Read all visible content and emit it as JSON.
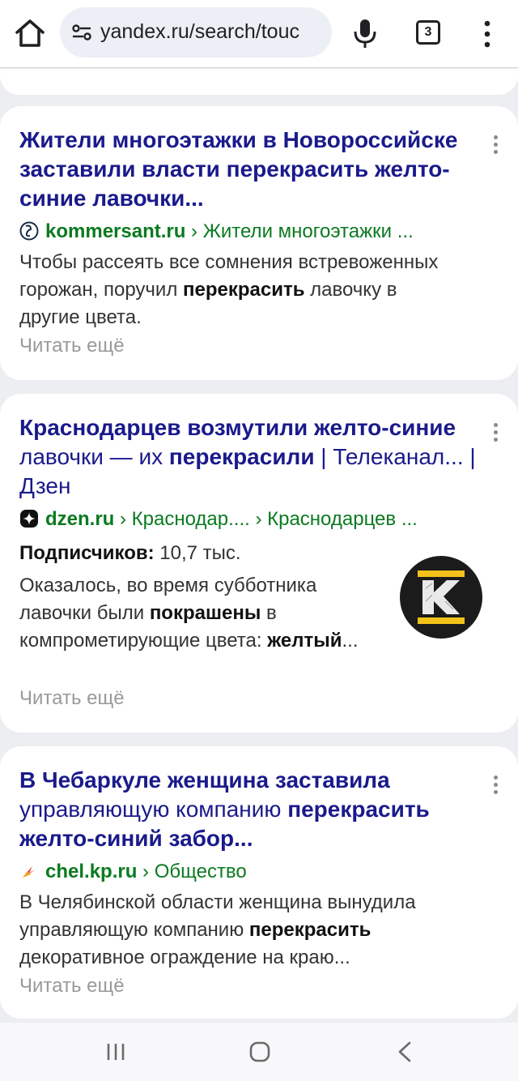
{
  "browser": {
    "url": "yandex.ru/search/touc",
    "tab_count": "3"
  },
  "results": [
    {
      "title_parts": [
        "Жители многоэтажки в Новороссийске заставили власти ",
        "перекрасить желто-синие лавочки..."
      ],
      "domain": "kommersant.ru",
      "breadcrumb": " › Жители многоэтажки ...",
      "snippet_pre": "Чтобы рассеять все сомнения встревоженных горожан, поручил ",
      "snippet_bold": "перекрасить",
      "snippet_post": " лавочку в другие цвета.",
      "more": "Читать ещё"
    },
    {
      "title_b1": "Краснодарцев возмутили желто-синие",
      "title_n1": " лавочки — их ",
      "title_b2": "перекрасили",
      "title_b3": " | Телеканал... | Дзен",
      "domain": "dzen.ru",
      "breadcrumb": " › Краснодар.... › Краснодарцев ...",
      "subs_label": "Подписчиков:",
      "subs_value": " 10,7 тыс.",
      "snippet_pre": "Оказалось, во время субботника лавочки были ",
      "snippet_bold": "покрашены",
      "snippet_post": " в компрометирующие цвета: ",
      "snippet_bold2": "желтый",
      "snippet_end": "...",
      "thumb_letter": "K",
      "more": "Читать ещё"
    },
    {
      "title_b1": "В Чебаркуле женщина заставила",
      "title_n1": " управляющую компанию ",
      "title_b2": "перекрасить",
      "title_b3": " желто-синий забор...",
      "domain": "chel.kp.ru",
      "breadcrumb": " › Общество",
      "snippet_pre": "В Челябинской области женщина вынудила управляющую компанию ",
      "snippet_bold": "перекрасить",
      "snippet_post": " декоративное ограждение на краю...",
      "more": "Читать ещё"
    }
  ],
  "colors": {
    "title": "#1a1a8c",
    "source": "#0b7a20",
    "muted": "#9a9a9a",
    "background": "#eceef2"
  }
}
